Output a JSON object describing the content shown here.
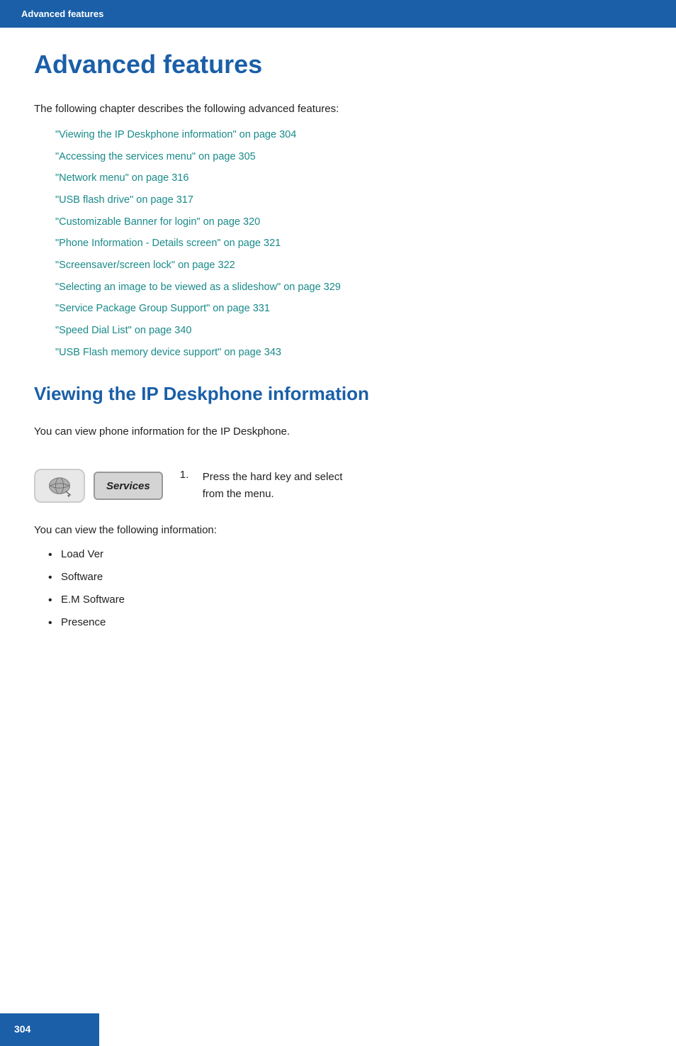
{
  "header": {
    "label": "Advanced features"
  },
  "page_title": "Advanced features",
  "intro": "The following chapter describes the following advanced features:",
  "toc": [
    {
      "text": "\"Viewing the IP Deskphone information\" on page 304"
    },
    {
      "text": "\"Accessing the services menu\" on page 305"
    },
    {
      "text": "\"Network menu\" on page 316"
    },
    {
      "text": "\"USB flash drive\" on page 317"
    },
    {
      "text": "\"Customizable Banner for login\" on page 320"
    },
    {
      "text": "\"Phone Information - Details screen\" on page 321"
    },
    {
      "text": "\"Screensaver/screen lock\" on page 322"
    },
    {
      "text": "\"Selecting an image to be viewed as a slideshow\" on page 329"
    },
    {
      "text": "\"Service Package Group Support\" on page 331"
    },
    {
      "text": "\"Speed Dial List\" on page 340"
    },
    {
      "text": "\"USB Flash memory device support\" on page 343"
    }
  ],
  "section_title": "Viewing the IP Deskphone information",
  "section_intro": "You can view phone information for the IP Deskphone.",
  "step": {
    "number": "1.",
    "press_label": "Press the",
    "services_label": "Services",
    "hard_key_desc": "hard key and select",
    "from_menu": "from the menu."
  },
  "info_section": {
    "intro": "You can view the following information:",
    "items": [
      "Load Ver",
      "Software",
      "E.M Software",
      "Presence"
    ]
  },
  "page_number": "304"
}
